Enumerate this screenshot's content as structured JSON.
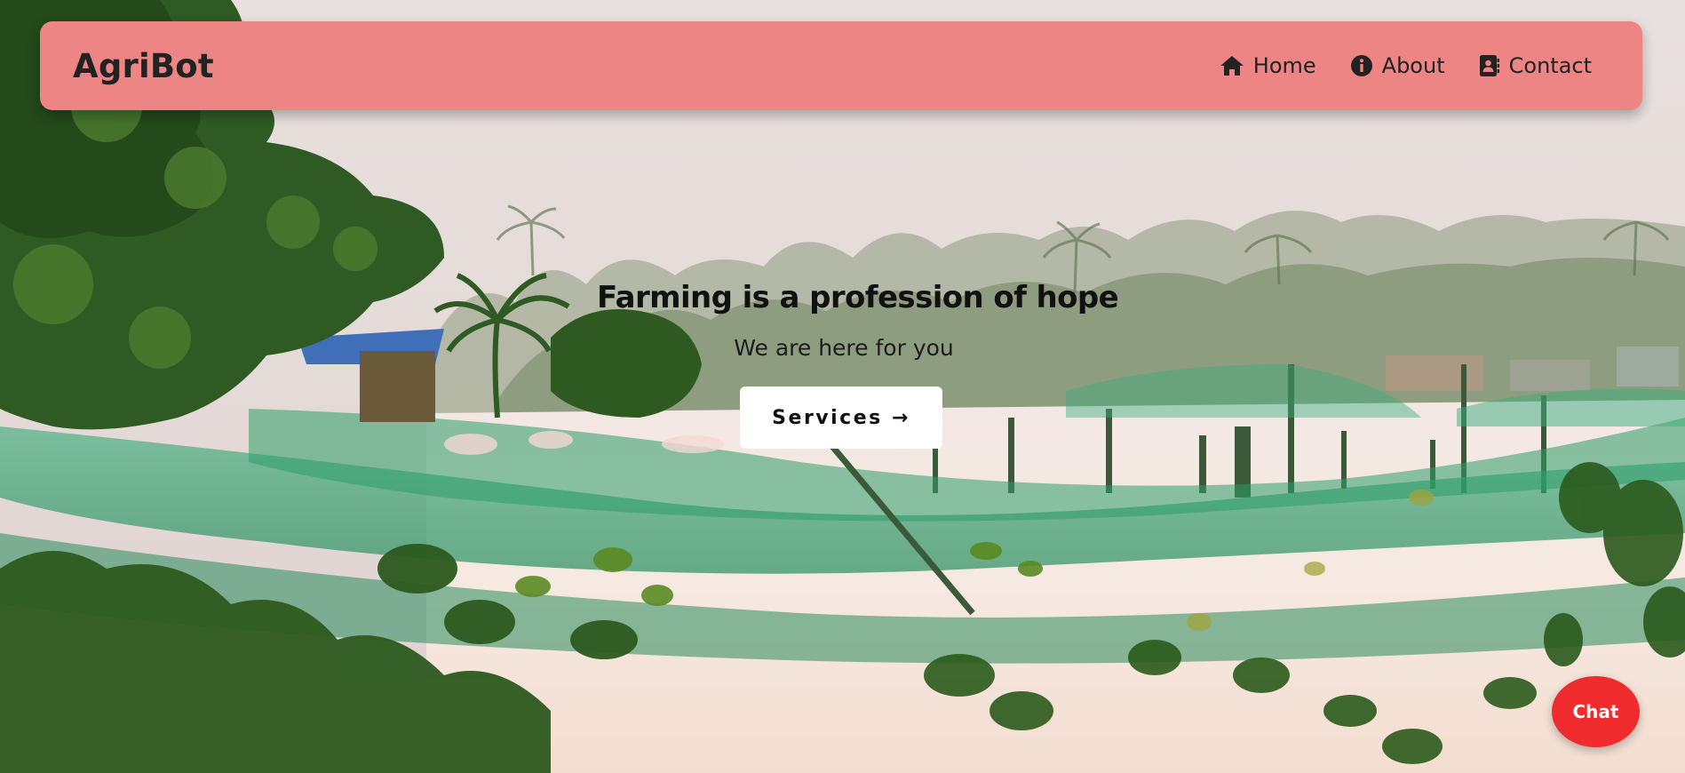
{
  "brand": {
    "name": "AgriBot"
  },
  "nav": {
    "items": [
      {
        "label": "Home",
        "icon": "home-icon"
      },
      {
        "label": "About",
        "icon": "info-icon"
      },
      {
        "label": "Contact",
        "icon": "contact-book-icon"
      }
    ]
  },
  "hero": {
    "title": "Farming is a profession of hope",
    "subtitle": "We are here for you",
    "cta_label": "Services →"
  },
  "chat": {
    "label": "Chat"
  },
  "colors": {
    "navbar_bg": "#ee8585",
    "chat_bg": "#ef2b2d",
    "cta_bg": "#ffffff",
    "text_dark": "#222222"
  }
}
